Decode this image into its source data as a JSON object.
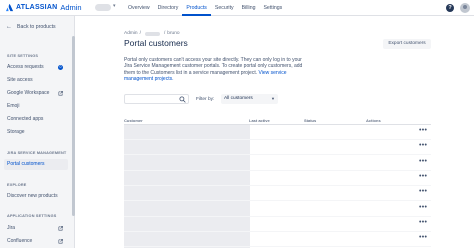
{
  "header": {
    "brand": "ATLASSIAN",
    "product": "Admin",
    "nav": [
      "Overview",
      "Directory",
      "Products",
      "Security",
      "Billing",
      "Settings"
    ],
    "active_nav": "Products",
    "help_glyph": "?"
  },
  "sidebar": {
    "back_label": "Back to products",
    "sections": [
      {
        "title": "SITE SETTINGS",
        "items": [
          {
            "label": "Access requests",
            "badge": "0"
          },
          {
            "label": "Site access"
          },
          {
            "label": "Google Workspace",
            "external": true
          },
          {
            "label": "Emoji"
          },
          {
            "label": "Connected apps"
          },
          {
            "label": "Storage"
          }
        ]
      },
      {
        "title": "JIRA SERVICE MANAGEMENT",
        "items": [
          {
            "label": "Portal customers",
            "active": true
          }
        ]
      },
      {
        "title": "EXPLORE",
        "items": [
          {
            "label": "Discover new products"
          }
        ]
      },
      {
        "title": "APPLICATION SETTINGS",
        "items": [
          {
            "label": "Jira",
            "external": true
          },
          {
            "label": "Confluence",
            "external": true
          }
        ]
      }
    ]
  },
  "main": {
    "breadcrumb": [
      "Admin",
      "bruno"
    ],
    "title": "Portal customers",
    "export_label": "Export customers",
    "description": "Portal only customers can't access your site directly. They can only log in to your Jira Service Management customer portals. To create portal only customers, add them to the Customers list in a service management project.",
    "description_link": "View service management projects.",
    "filter_label": "Filter by:",
    "filter_value": "All customers",
    "columns": [
      "Customer",
      "Last active",
      "Status",
      "Actions"
    ],
    "row_count": 8,
    "more_glyph": "•••"
  },
  "colors": {
    "accent": "#0052cc",
    "text": "#172b4d",
    "muted": "#6b778c",
    "sidebar_bg": "#f4f5f7"
  }
}
